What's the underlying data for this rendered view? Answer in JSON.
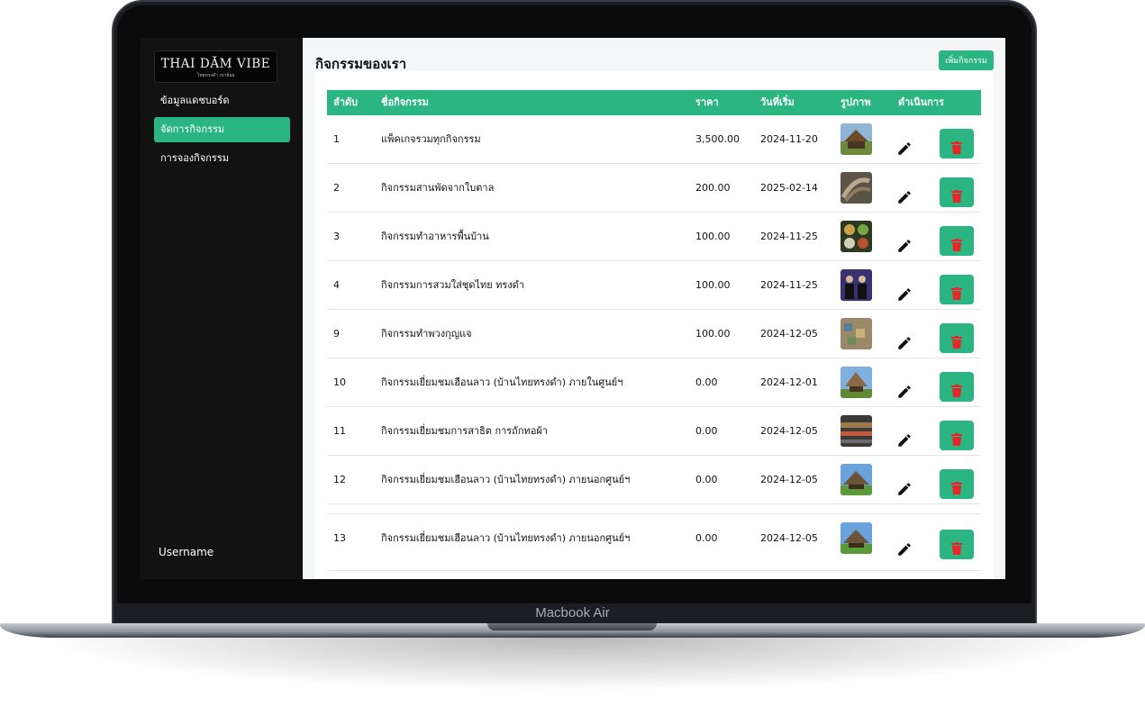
{
  "device_label": "Macbook Air",
  "logo": {
    "title": "THAI DĂM VIBE",
    "subtitle": "ไทยทรงดำ เขาย้อย"
  },
  "sidebar": {
    "items": [
      {
        "label": "ข้อมูลแดชบอร์ด",
        "active": false
      },
      {
        "label": "จัดการกิจกรรม",
        "active": true
      },
      {
        "label": "การจองกิจกรรม",
        "active": false
      }
    ],
    "username": "Username"
  },
  "page": {
    "title": "กิจกรรมของเรา",
    "add_button": "เพิ่มกิจกรรม"
  },
  "table": {
    "headers": {
      "index": "ลำดับ",
      "name": "ชื่อกิจกรรม",
      "price": "ราคา",
      "start_date": "วันที่เริ่ม",
      "image": "รูปภาพ",
      "actions": "ดำเนินการ"
    },
    "rows": [
      {
        "index": "1",
        "name": "แพ็คเกจรวมทุกกิจกรรม",
        "price": "3,500.00",
        "start_date": "2024-11-20",
        "thumb": "thatched-house-photo"
      },
      {
        "index": "2",
        "name": "กิจกรรมสานพัดจากใบตาล",
        "price": "200.00",
        "start_date": "2025-02-14",
        "thumb": "palm-leaf-weaving-photo"
      },
      {
        "index": "3",
        "name": "กิจกรรมทำอาหารพื้นบ้าน",
        "price": "100.00",
        "start_date": "2024-11-25",
        "thumb": "local-food-photo"
      },
      {
        "index": "4",
        "name": "กิจกรรมการสวมใส่ชุดไทย ทรงดำ",
        "price": "100.00",
        "start_date": "2024-11-25",
        "thumb": "traditional-dress-photo"
      },
      {
        "index": "9",
        "name": "กิจกรรมทำพวงกุญแจ",
        "price": "100.00",
        "start_date": "2024-12-05",
        "thumb": "keychain-craft-photo"
      },
      {
        "index": "10",
        "name": "กิจกรรมเยี่ยมชมเฮือนลาว (บ้านไทยทรงดำ) ภายในศูนย์ฯ",
        "price": "0.00",
        "start_date": "2024-12-01",
        "thumb": "lao-house-photo"
      },
      {
        "index": "11",
        "name": "กิจกรรมเยี่ยมชมการสาธิต การถักทอผ้า",
        "price": "0.00",
        "start_date": "2024-12-05",
        "thumb": "weaving-loom-photo"
      },
      {
        "index": "12",
        "name": "กิจกรรมเยี่ยมชมเฮือนลาว (บ้านไทยทรงดำ) ภายนอกศูนย์ฯ",
        "price": "0.00",
        "start_date": "2024-12-05",
        "thumb": "outdoor-house-photo"
      },
      {
        "index": "13",
        "name": "กิจกรรมเยี่ยมชมเฮือนลาว (บ้านไทยทรงดำ) ภายนอกศูนย์ฯ",
        "price": "0.00",
        "start_date": "2024-12-05",
        "thumb": "outdoor-house-photo"
      }
    ]
  },
  "colors": {
    "accent": "#2bb583",
    "sidebar_bg": "#121212",
    "delete_icon": "#e8262a"
  }
}
